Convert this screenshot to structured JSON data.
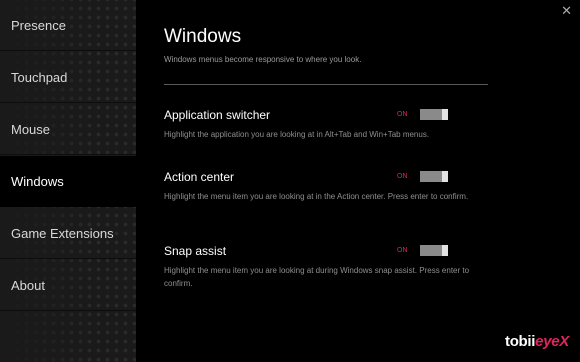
{
  "sidebar": {
    "items": [
      {
        "label": "Presence"
      },
      {
        "label": "Touchpad"
      },
      {
        "label": "Mouse"
      },
      {
        "label": "Windows"
      },
      {
        "label": "Game Extensions"
      },
      {
        "label": "About"
      }
    ],
    "active_index": 3
  },
  "window": {
    "close_glyph": "✕"
  },
  "main": {
    "title": "Windows",
    "description": "Windows menus become responsive to where you look.",
    "settings": [
      {
        "title": "Application switcher",
        "state": "ON",
        "description": "Highlight the application you are looking at in Alt+Tab and Win+Tab menus."
      },
      {
        "title": "Action center",
        "state": "ON",
        "description": "Highlight the menu item you are looking at in the Action center. Press enter to confirm."
      },
      {
        "title": "Snap assist",
        "state": "ON",
        "description": "Highlight the menu item you are looking at during Windows snap assist. Press enter to confirm."
      }
    ]
  },
  "logo": {
    "brand": "tobii",
    "product": "eyeX"
  },
  "colors": {
    "accent": "#e0245e",
    "background": "#000000",
    "sidebar": "#1a1a1a"
  }
}
